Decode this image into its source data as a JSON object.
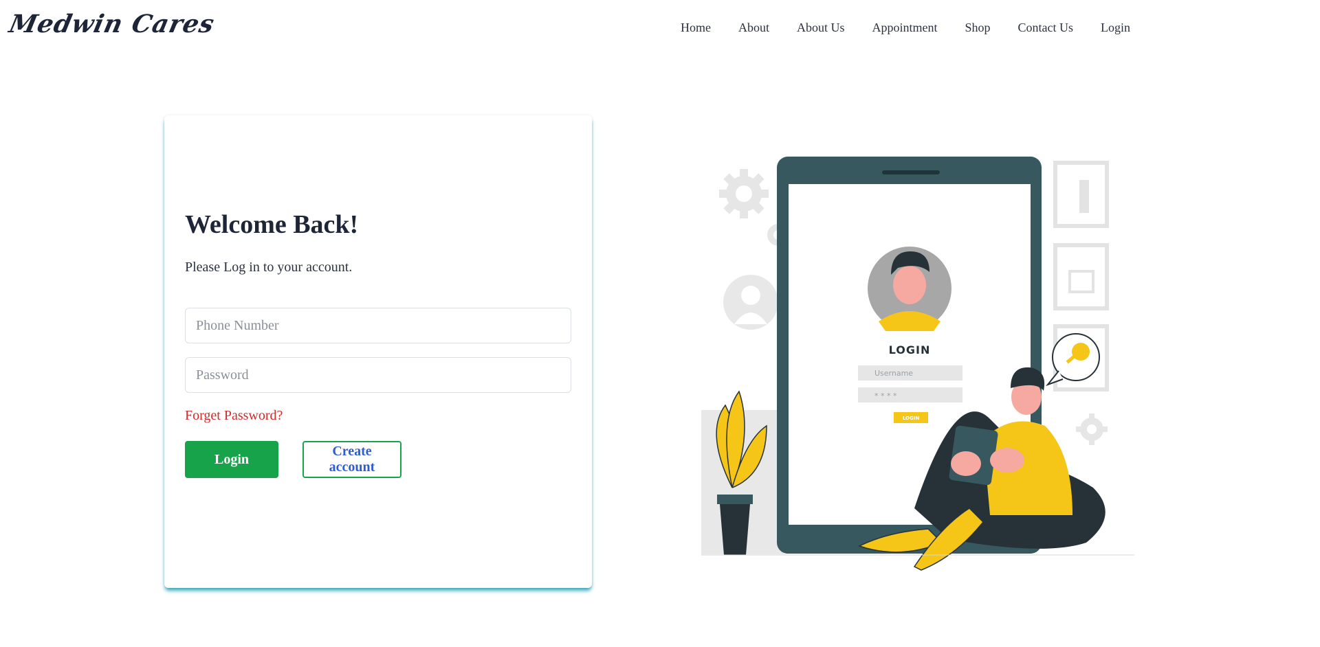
{
  "brand": {
    "name": "Medwin Cares"
  },
  "nav": {
    "items": [
      {
        "label": "Home"
      },
      {
        "label": "About"
      },
      {
        "label": "About Us"
      },
      {
        "label": "Appointment"
      },
      {
        "label": "Shop"
      },
      {
        "label": "Contact Us"
      },
      {
        "label": "Login"
      }
    ]
  },
  "login_form": {
    "title": "Welcome Back!",
    "subtitle": "Please Log in to your account.",
    "phone_placeholder": "Phone Number",
    "password_placeholder": "Password",
    "forget_label": "Forget Password?",
    "login_label": "Login",
    "create_label": "Create account"
  },
  "illustration": {
    "screen_title": "LOGIN",
    "username_placeholder": "Username",
    "password_mask": "* * * *",
    "button_label": "LOGIN"
  },
  "colors": {
    "accent_green": "#17a34a",
    "link_blue": "#2c5dd4",
    "error_red": "#d12b2b",
    "phone_frame": "#37585f",
    "highlight_yellow": "#f5c518"
  }
}
